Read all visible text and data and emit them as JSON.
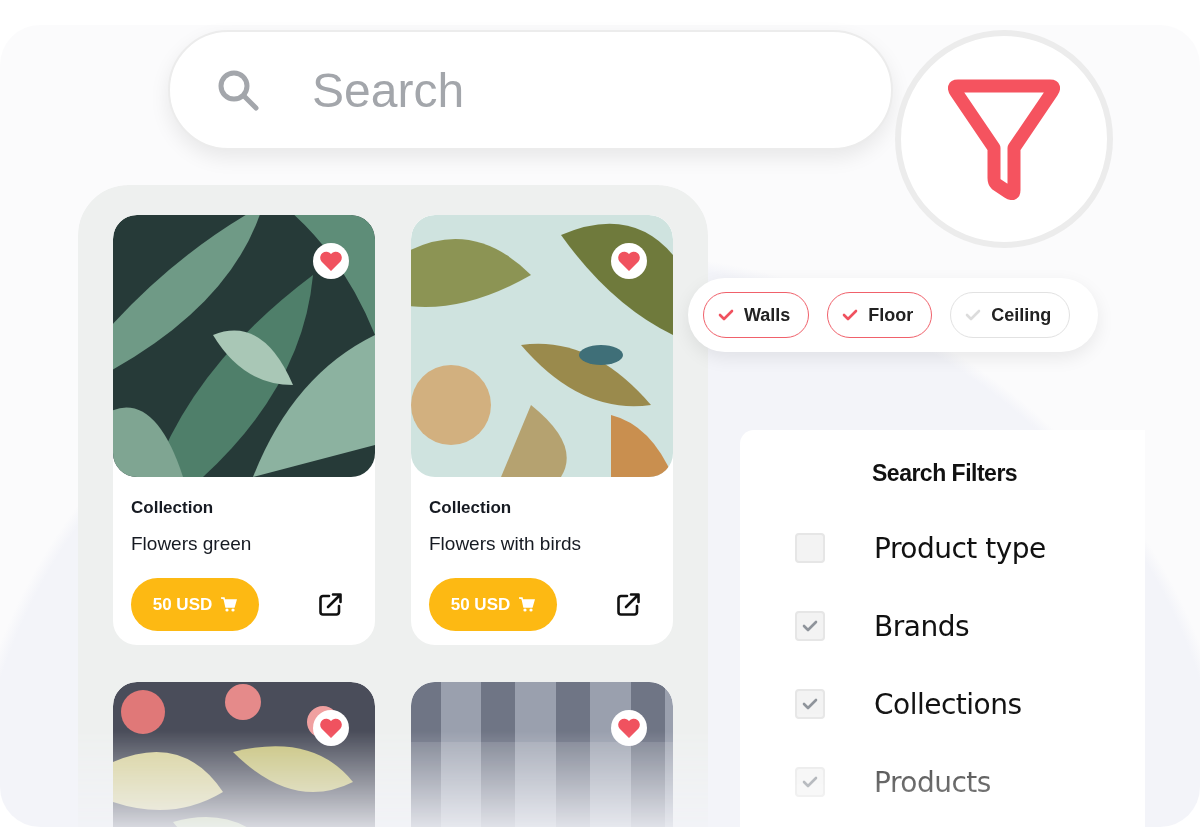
{
  "search": {
    "placeholder": "Search"
  },
  "products": [
    {
      "kind": "full",
      "category": "Collection",
      "name": "Flowers green",
      "price": "50 USD"
    },
    {
      "kind": "full",
      "category": "Collection",
      "name": "Flowers with birds",
      "price": "50 USD"
    },
    {
      "kind": "cropped"
    },
    {
      "kind": "cropped"
    }
  ],
  "tags": [
    {
      "label": "Walls",
      "selected": true
    },
    {
      "label": "Floor",
      "selected": true
    },
    {
      "label": "Ceiling",
      "selected": false
    }
  ],
  "filters": {
    "title": "Search Filters",
    "options": [
      {
        "label": "Product type",
        "checked": false
      },
      {
        "label": "Brands",
        "checked": true
      },
      {
        "label": "Collections",
        "checked": true
      },
      {
        "label": "Products",
        "checked": true
      }
    ]
  }
}
